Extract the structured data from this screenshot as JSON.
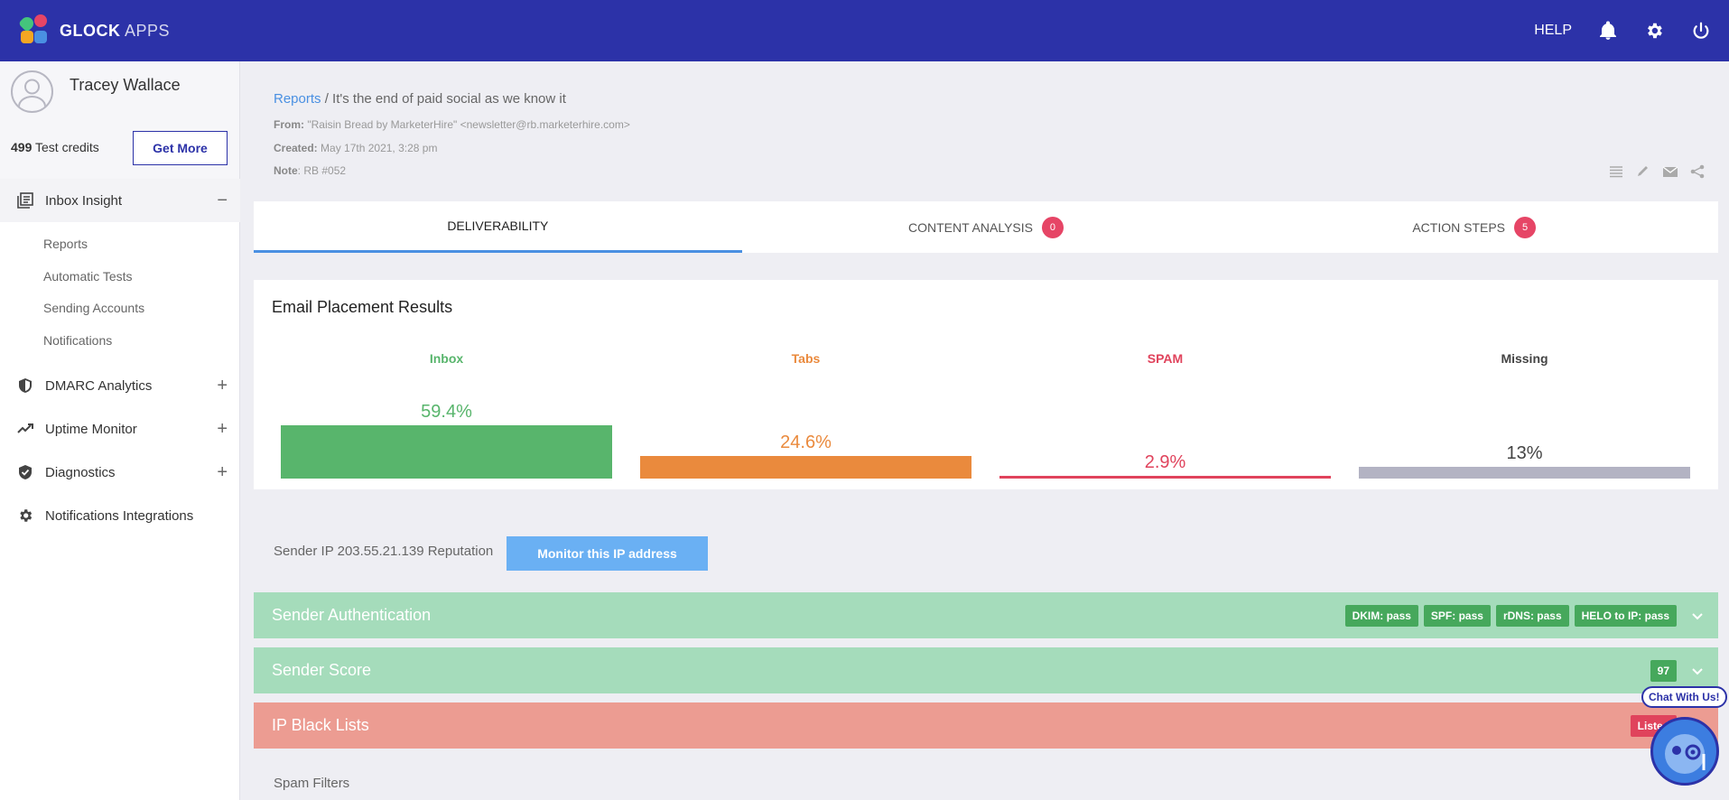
{
  "header": {
    "brand_bold": "GLOCK",
    "brand_light": "APPS",
    "help_label": "HELP",
    "icons": [
      "bell-icon",
      "gear-icon",
      "power-icon"
    ]
  },
  "sidebar": {
    "user_name": "Tracey Wallace",
    "credits_count": "499",
    "credits_label": "Test credits",
    "get_more_label": "Get More",
    "items": [
      {
        "label": "Inbox Insight",
        "icon": "inbox-icon",
        "toggle": "−"
      },
      {
        "label": "DMARC Analytics",
        "icon": "shield-icon",
        "toggle": "+"
      },
      {
        "label": "Uptime Monitor",
        "icon": "trend-icon",
        "toggle": "+"
      },
      {
        "label": "Diagnostics",
        "icon": "check-shield-icon",
        "toggle": "+"
      },
      {
        "label": "Notifications Integrations",
        "icon": "gear-icon",
        "toggle": ""
      }
    ],
    "subitems": [
      "Reports",
      "Automatic Tests",
      "Sending Accounts",
      "Notifications"
    ]
  },
  "report": {
    "breadcrumb_link": "Reports",
    "breadcrumb_sep": " / ",
    "title": "It's the end of paid social as we know it",
    "from_label": "From:",
    "from_value": "\"Raisin Bread by MarketerHire\" <newsletter@rb.marketerhire.com>",
    "created_label": "Created:",
    "created_value": "May 17th 2021, 3:28 pm",
    "note_label": "Note",
    "note_value": ": RB #052"
  },
  "tabs": [
    {
      "label": "DELIVERABILITY",
      "badge": ""
    },
    {
      "label": "CONTENT ANALYSIS",
      "badge": "0"
    },
    {
      "label": "ACTION STEPS",
      "badge": "5"
    }
  ],
  "placement": {
    "title": "Email Placement Results",
    "columns": [
      {
        "label": "Inbox",
        "value": "59.4%",
        "fraction": 0.594,
        "color": "#58b56c"
      },
      {
        "label": "Tabs",
        "value": "24.6%",
        "fraction": 0.246,
        "color": "#ea8a3d"
      },
      {
        "label": "SPAM",
        "value": "2.9%",
        "fraction": 0.029,
        "color": "#e0435c"
      },
      {
        "label": "Missing",
        "value": "13%",
        "fraction": 0.13,
        "color": "#b3b3c3"
      }
    ]
  },
  "sender_ip": {
    "text": "Sender IP 203.55.21.139 Reputation",
    "button": "Monitor this IP address"
  },
  "sections": [
    {
      "title": "Sender Authentication",
      "status": "green",
      "pills": [
        "DKIM: pass",
        "SPF: pass",
        "rDNS: pass",
        "HELO to IP: pass"
      ]
    },
    {
      "title": "Sender Score",
      "status": "green",
      "pills": [
        "97"
      ]
    },
    {
      "title": "IP Black Lists",
      "status": "red",
      "pills": [
        "Listed"
      ]
    }
  ],
  "spam_filters_label": "Spam Filters",
  "chat_label": "Chat With Us!"
}
